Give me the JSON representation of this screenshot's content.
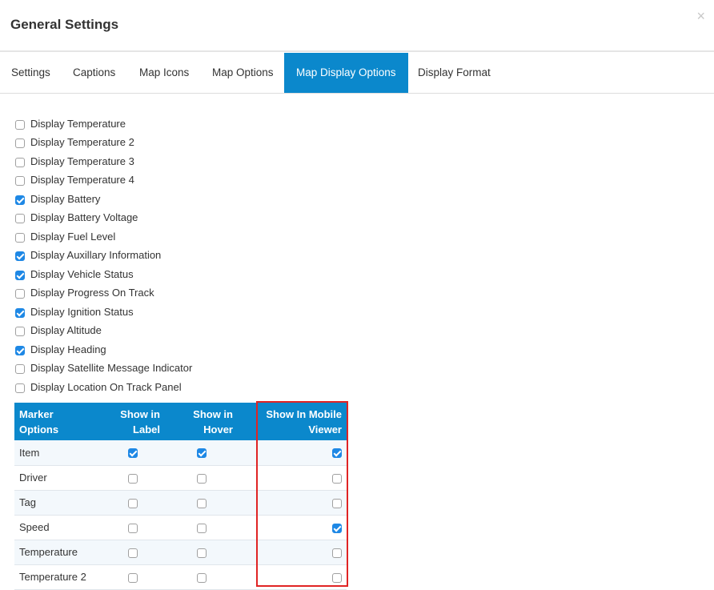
{
  "dialog": {
    "title": "General Settings",
    "close_glyph": "×"
  },
  "tabs": [
    {
      "label": "Settings",
      "active": false
    },
    {
      "label": "Captions",
      "active": false
    },
    {
      "label": "Map Icons",
      "active": false
    },
    {
      "label": "Map Options",
      "active": false
    },
    {
      "label": "Map Display Options",
      "active": true
    },
    {
      "label": "Display Format",
      "active": false
    }
  ],
  "options": [
    {
      "label": "Display Temperature",
      "checked": false
    },
    {
      "label": "Display Temperature 2",
      "checked": false
    },
    {
      "label": "Display Temperature 3",
      "checked": false
    },
    {
      "label": "Display Temperature 4",
      "checked": false
    },
    {
      "label": "Display Battery",
      "checked": true
    },
    {
      "label": "Display Battery Voltage",
      "checked": false
    },
    {
      "label": "Display Fuel Level",
      "checked": false
    },
    {
      "label": "Display Auxillary Information",
      "checked": true
    },
    {
      "label": "Display Vehicle Status",
      "checked": true
    },
    {
      "label": "Display Progress On Track",
      "checked": false
    },
    {
      "label": "Display Ignition Status",
      "checked": true
    },
    {
      "label": "Display Altitude",
      "checked": false
    },
    {
      "label": "Display Heading",
      "checked": true
    },
    {
      "label": "Display Satellite Message Indicator",
      "checked": false
    },
    {
      "label": "Display Location On Track Panel",
      "checked": false
    }
  ],
  "marker_table": {
    "headers": {
      "col1_line1": "Marker",
      "col1_line2": "Options",
      "col2_line1": "Show in",
      "col2_line2": "Label",
      "col3_line1": "Show in",
      "col3_line2": "Hover",
      "col4_line1": "Show In Mobile",
      "col4_line2": "Viewer"
    },
    "rows": [
      {
        "name": "Item",
        "label": true,
        "hover": true,
        "mobile": true
      },
      {
        "name": "Driver",
        "label": false,
        "hover": false,
        "mobile": false
      },
      {
        "name": "Tag",
        "label": false,
        "hover": false,
        "mobile": false
      },
      {
        "name": "Speed",
        "label": false,
        "hover": false,
        "mobile": true
      },
      {
        "name": "Temperature",
        "label": false,
        "hover": false,
        "mobile": false
      },
      {
        "name": "Temperature 2",
        "label": false,
        "hover": false,
        "mobile": false
      }
    ]
  },
  "colors": {
    "accent": "#0b88cc",
    "checkbox_checked": "#1e88e5",
    "highlight_border": "#e02424"
  }
}
